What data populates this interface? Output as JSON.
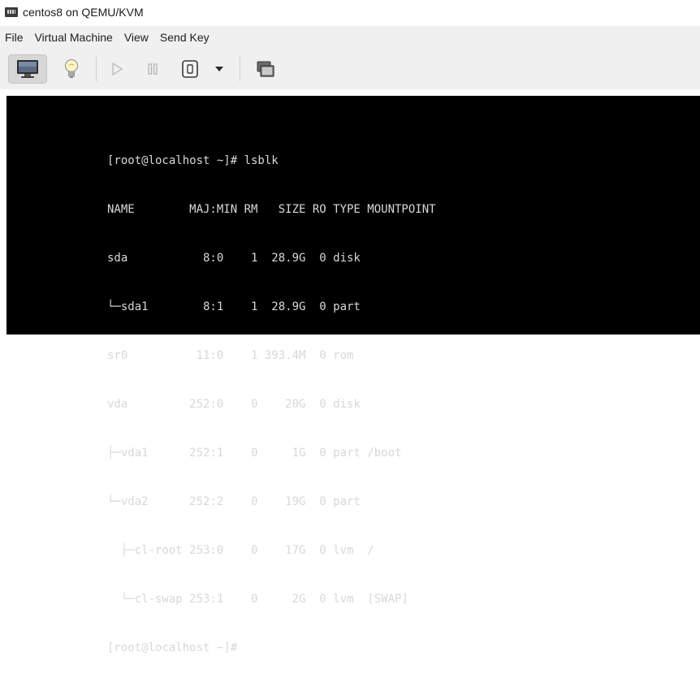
{
  "window": {
    "title": "centos8 on QEMU/KVM",
    "app_icon": "vm-monitor-icon"
  },
  "menubar": {
    "items": [
      "File",
      "Virtual Machine",
      "View",
      "Send Key"
    ]
  },
  "toolbar": {
    "buttons": [
      {
        "name": "console-view-button",
        "icon": "monitor-icon"
      },
      {
        "name": "details-view-button",
        "icon": "lightbulb-icon"
      },
      {
        "name": "run-button",
        "icon": "play-icon"
      },
      {
        "name": "pause-button",
        "icon": "pause-icon"
      },
      {
        "name": "shutdown-button",
        "icon": "power-icon"
      },
      {
        "name": "shutdown-menu-button",
        "icon": "chevron-down-icon"
      },
      {
        "name": "fullscreen-button",
        "icon": "fullscreen-icon"
      }
    ]
  },
  "console": {
    "background": "#000000",
    "text_color": "#d8d8d8",
    "lines": [
      "[root@localhost ~]# lsblk",
      "NAME        MAJ:MIN RM   SIZE RO TYPE MOUNTPOINT",
      "sda           8:0    1  28.9G  0 disk",
      "└─sda1        8:1    1  28.9G  0 part",
      "sr0          11:0    1 393.4M  0 rom",
      "vda         252:0    0    20G  0 disk",
      "├─vda1      252:1    0     1G  0 part /boot",
      "└─vda2      252:2    0    19G  0 part",
      "  ├─cl-root 253:0    0    17G  0 lvm  /",
      "  └─cl-swap 253:1    0     2G  0 lvm  [SWAP]",
      "[root@localhost ~]#"
    ]
  }
}
